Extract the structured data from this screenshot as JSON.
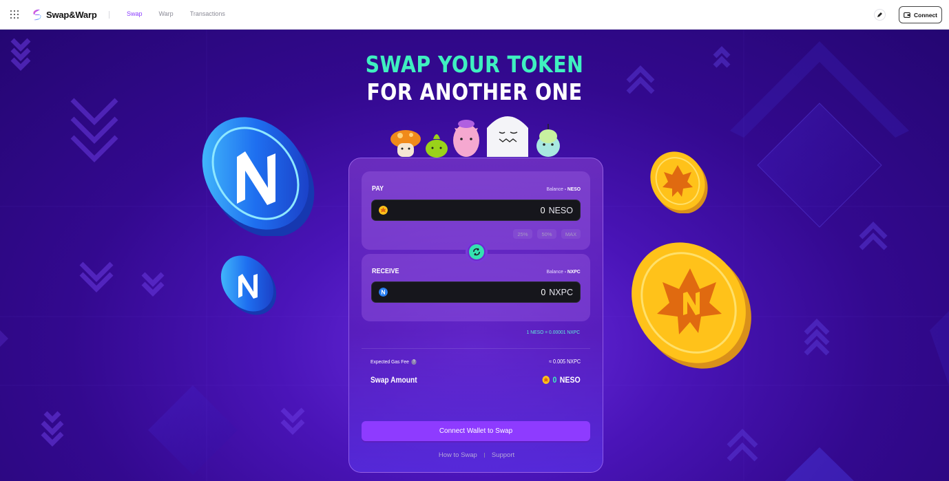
{
  "header": {
    "brand": "Swap&Warp",
    "nav": [
      {
        "label": "Swap",
        "active": true
      },
      {
        "label": "Warp",
        "active": false
      },
      {
        "label": "Transactions",
        "active": false
      }
    ],
    "connect_label": "Connect",
    "icons": [
      "apps-grid-icon",
      "swapwarp-logo-icon",
      "pen-icon",
      "wallet-icon"
    ]
  },
  "hero": {
    "line1": "SWAP YOUR TOKEN",
    "line2": "FOR ANOTHER ONE"
  },
  "swap_card": {
    "pay": {
      "title": "PAY",
      "balance_label": "Balance",
      "balance_value": "- NESO",
      "amount": "0",
      "token": "NESO",
      "percent_buttons": [
        "25%",
        "50%",
        "MAX"
      ]
    },
    "receive": {
      "title": "RECEIVE",
      "balance_label": "Balance",
      "balance_value": "- NXPC",
      "amount": "0",
      "token": "NXPC"
    },
    "rate": "1 NESO = 0.00001 NXPC",
    "gas_fee_label": "Expected Gas Fee",
    "gas_fee_value": "≈ 0.005 NXPC",
    "swap_amount_label": "Swap Amount",
    "swap_amount_value": "0",
    "swap_amount_token": "NESO",
    "cta_label": "Connect Wallet to Swap",
    "footer_links": [
      "How to Swap",
      "Support"
    ]
  },
  "colors": {
    "accent_purple": "#8e3bff",
    "accent_mint": "#3ff0c0",
    "bg_purple": "#33098f"
  }
}
